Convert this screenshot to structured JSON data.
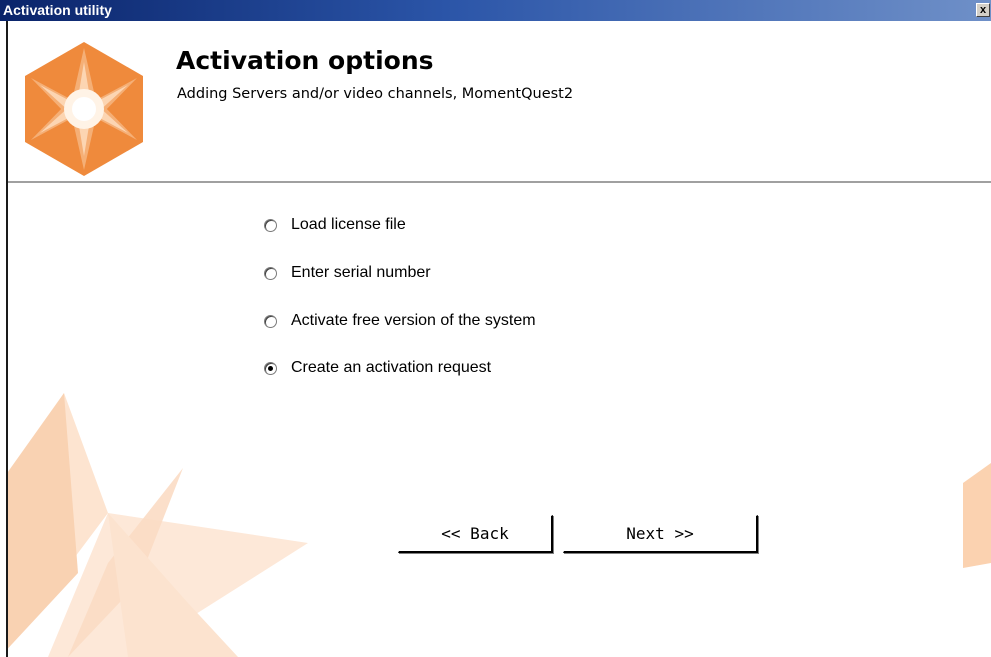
{
  "window": {
    "title": "Activation utility",
    "close_glyph": "x"
  },
  "header": {
    "title": "Activation options",
    "subtitle": "Adding Servers and/or video channels, MomentQuest2",
    "logo_icon": "orange-star-hexagon-logo"
  },
  "options": [
    {
      "label": "Load license file",
      "selected": false
    },
    {
      "label": "Enter serial number",
      "selected": false
    },
    {
      "label": "Activate free version of the system",
      "selected": false
    },
    {
      "label": "Create an activation request",
      "selected": true
    }
  ],
  "buttons": {
    "back_label": "<< Back",
    "next_label": "Next >>"
  },
  "colors": {
    "accent_orange": "#f0883a",
    "light_orange": "#f8c8a0",
    "titlebar": "#0a246a"
  }
}
